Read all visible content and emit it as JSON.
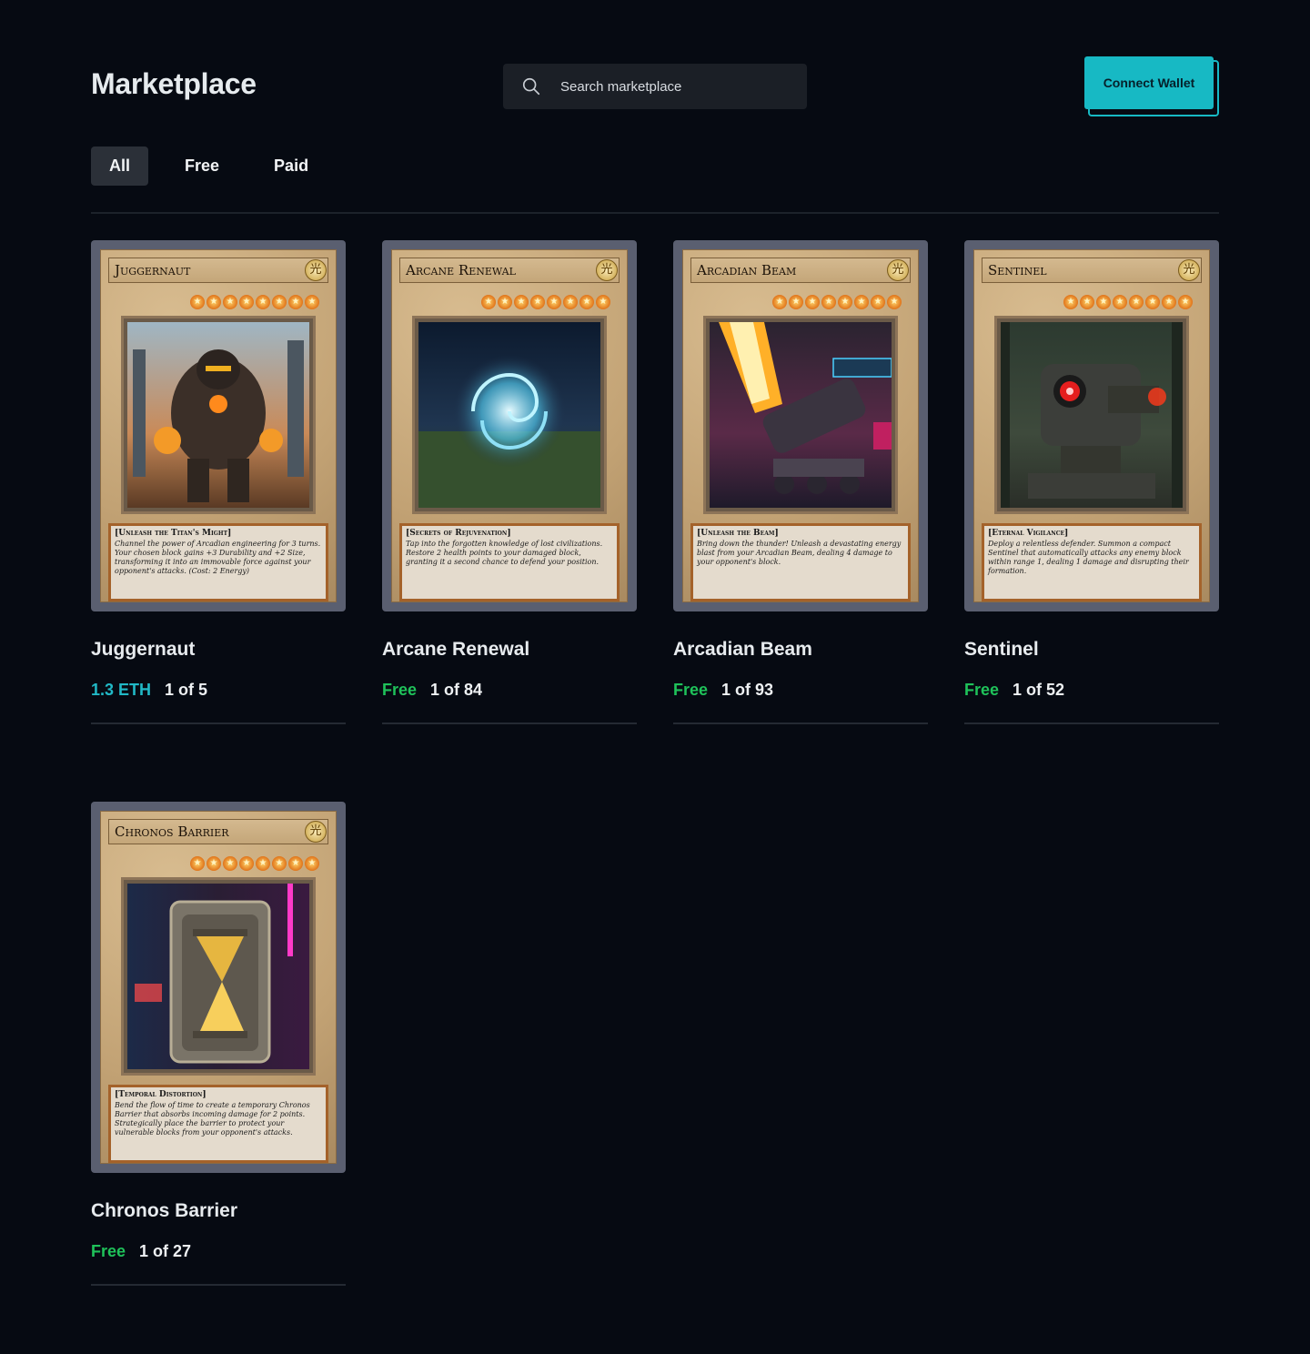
{
  "header": {
    "title": "Marketplace",
    "search_placeholder": "Search marketplace",
    "wallet_label": "Connect Wallet"
  },
  "tabs": [
    {
      "label": "All",
      "active": true
    },
    {
      "label": "Free",
      "active": false
    },
    {
      "label": "Paid",
      "active": false
    }
  ],
  "colors": {
    "background": "#060a12",
    "accent": "#17b9c4",
    "price_eth": "#21b9c6",
    "price_free": "#1fc25a"
  },
  "items": [
    {
      "card_name": "Juggernaut",
      "ability_title": "[Unleash the Titan's Might]",
      "ability_text": "Channel the power of Arcadian engineering for 3 turns. Your chosen block gains +3 Durability and +2 Size, transforming it into an immovable force against your opponent's attacks. (Cost: 2 Energy)",
      "title": "Juggernaut",
      "price": "1.3 ETH",
      "price_type": "eth",
      "edition": "1 of 5"
    },
    {
      "card_name": "Arcane Renewal",
      "ability_title": "[Secrets of Rejuvenation]",
      "ability_text": "Tap into the forgotten knowledge of lost civilizations. Restore 2 health points to your damaged block, granting it a second chance to defend your position.",
      "title": "Arcane Renewal",
      "price": "Free",
      "price_type": "free",
      "edition": "1 of 84"
    },
    {
      "card_name": "Arcadian Beam",
      "ability_title": "[Unleash the Beam]",
      "ability_text": "Bring down the thunder! Unleash a devastating energy blast from your Arcadian Beam, dealing 4 damage to your opponent's block.",
      "title": "Arcadian Beam",
      "price": "Free",
      "price_type": "free",
      "edition": "1 of 93"
    },
    {
      "card_name": "Sentinel",
      "ability_title": "[Eternal Vigilance]",
      "ability_text": "Deploy a relentless defender. Summon a compact Sentinel that automatically attacks any enemy block within range 1, dealing 1 damage and disrupting their formation.",
      "title": "Sentinel",
      "price": "Free",
      "price_type": "free",
      "edition": "1 of 52"
    },
    {
      "card_name": "Chronos Barrier",
      "ability_title": "[Temporal Distortion]",
      "ability_text": "Bend the flow of time to create a temporary Chronos Barrier that absorbs incoming damage for 2 points. Strategically place the barrier to protect your vulnerable blocks from your opponent's attacks.",
      "title": "Chronos Barrier",
      "price": "Free",
      "price_type": "free",
      "edition": "1 of 27"
    }
  ],
  "card_symbols": {
    "attribute": "光",
    "star": "★"
  }
}
